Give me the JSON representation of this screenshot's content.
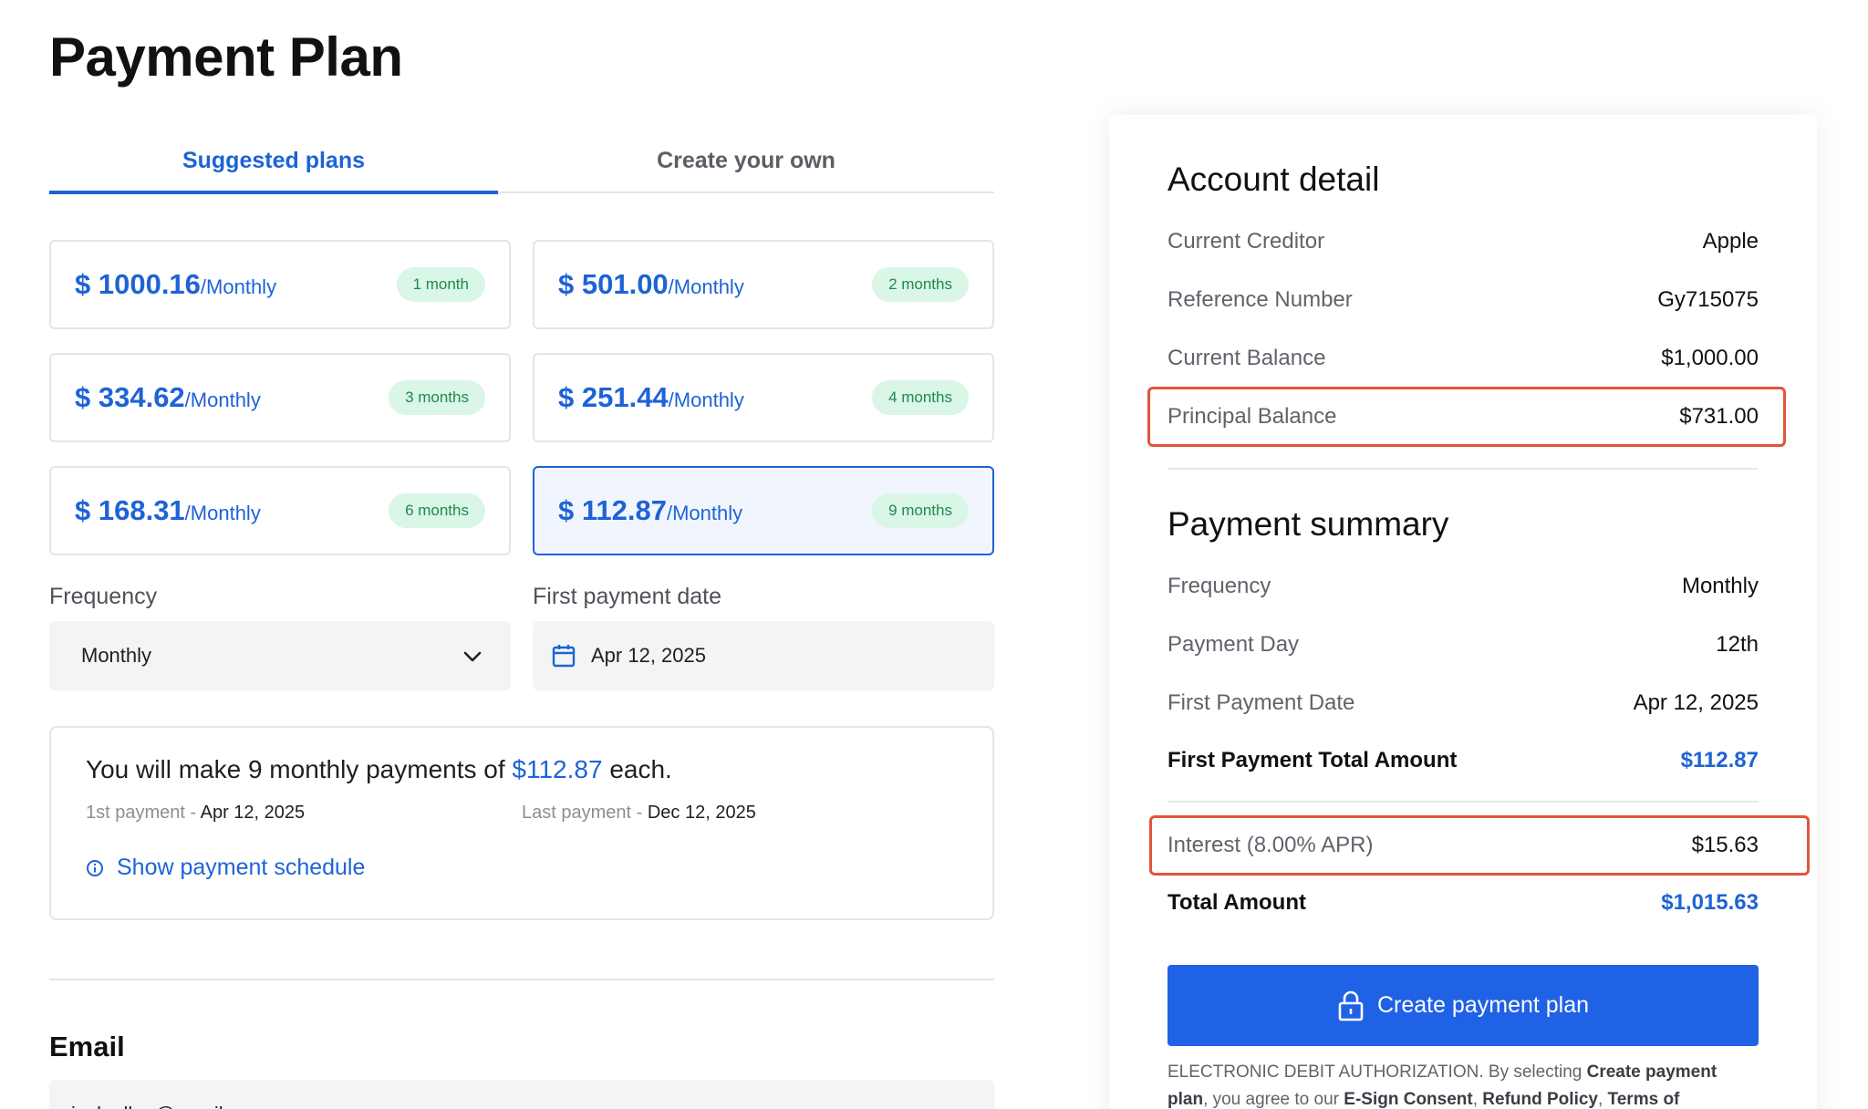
{
  "page": {
    "title": "Payment Plan"
  },
  "tabs": [
    {
      "label": "Suggested plans",
      "active": true
    },
    {
      "label": "Create your own",
      "active": false
    }
  ],
  "plans": [
    {
      "amount": "$ 1000.16",
      "unit": "/Monthly",
      "duration": "1 month",
      "selected": false
    },
    {
      "amount": "$ 501.00",
      "unit": "/Monthly",
      "duration": "2 months",
      "selected": false
    },
    {
      "amount": "$ 334.62",
      "unit": "/Monthly",
      "duration": "3 months",
      "selected": false
    },
    {
      "amount": "$ 251.44",
      "unit": "/Monthly",
      "duration": "4 months",
      "selected": false
    },
    {
      "amount": "$ 168.31",
      "unit": "/Monthly",
      "duration": "6 months",
      "selected": false
    },
    {
      "amount": "$ 112.87",
      "unit": "/Monthly",
      "duration": "9 months",
      "selected": true
    }
  ],
  "frequency": {
    "label": "Frequency",
    "value": "Monthly"
  },
  "first_payment_date": {
    "label": "First payment date",
    "value": "Apr 12, 2025"
  },
  "summary": {
    "sentence_prefix": "You will make 9 monthly payments of ",
    "amount": "$112.87",
    "sentence_suffix": " each.",
    "first_label": "1st payment - ",
    "first_value": "Apr 12, 2025",
    "last_label": "Last payment - ",
    "last_value": "Dec 12, 2025",
    "show_schedule": "Show payment schedule"
  },
  "email": {
    "heading": "Email",
    "value": "jack.allen@gmail.com"
  },
  "account_detail": {
    "heading": "Account detail",
    "rows": [
      {
        "key": "Current Creditor",
        "value": "Apple"
      },
      {
        "key": "Reference Number",
        "value": "Gy715075"
      },
      {
        "key": "Current Balance",
        "value": "$1,000.00"
      },
      {
        "key": "Principal Balance",
        "value": "$731.00"
      }
    ]
  },
  "payment_summary": {
    "heading": "Payment summary",
    "frequency_key": "Frequency",
    "frequency_value": "Monthly",
    "day_key": "Payment Day",
    "day_value": "12th",
    "first_date_key": "First Payment Date",
    "first_date_value": "Apr 12, 2025",
    "first_total_key": "First Payment Total Amount",
    "first_total_value": "$112.87",
    "interest_key": "Interest (8.00% APR)",
    "interest_value": "$15.63",
    "total_key": "Total Amount",
    "total_value": "$1,015.63"
  },
  "create_button": {
    "label": "Create payment plan"
  },
  "legal": {
    "text1": "ELECTRONIC DEBIT AUTHORIZATION. By selecting ",
    "bold1": "Create payment plan",
    "text2": ", you agree to our ",
    "bold2": "E-Sign Consent",
    "sep1": ", ",
    "bold3": "Refund Policy",
    "sep2": ", ",
    "bold4": "Terms of"
  },
  "colors": {
    "accent": "#1e63d6",
    "button": "#2062e6",
    "badge_bg": "#d9f6e6",
    "badge_text": "#1f8a4f",
    "highlight": "#e0553b"
  }
}
